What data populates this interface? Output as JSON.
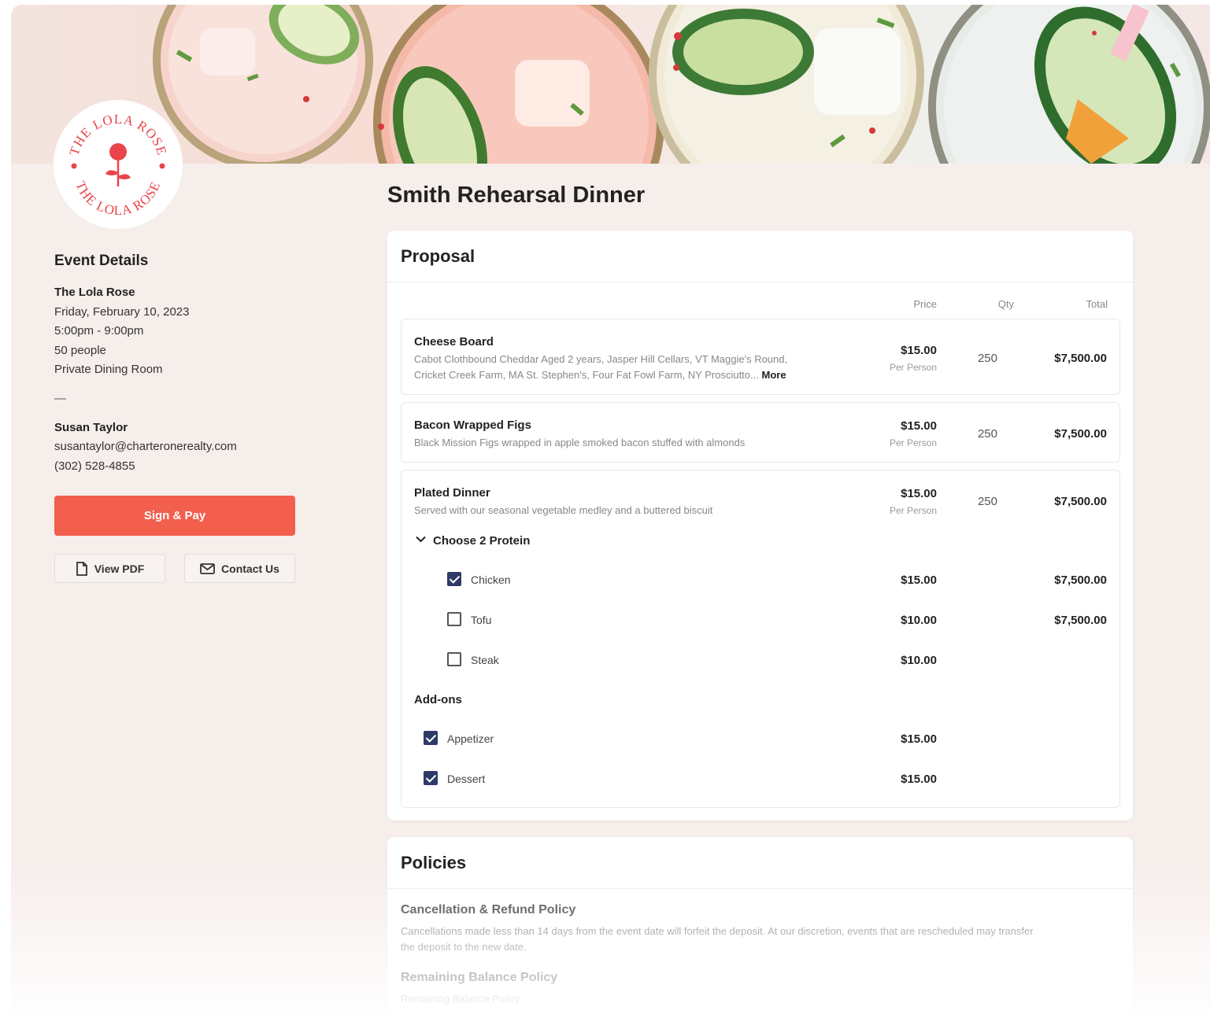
{
  "brand": {
    "logo_text_top": "THE LOLA ROSE",
    "logo_text_bottom": "THE LOLA ROSE",
    "accent_color": "#f25f4c",
    "logo_color": "#e8444a",
    "checkbox_color": "#2e3a66"
  },
  "event": {
    "heading": "Event Details",
    "venue": "The Lola Rose",
    "date": "Friday, February 10, 2023",
    "time": "5:00pm - 9:00pm",
    "guests": "50 people",
    "room": "Private Dining Room",
    "separator": "—",
    "contact_name": "Susan Taylor",
    "contact_email": "susantaylor@charteronerealty.com",
    "contact_phone": "(302) 528-4855"
  },
  "actions": {
    "sign_pay": "Sign & Pay",
    "view_pdf": "View PDF",
    "contact_us": "Contact Us"
  },
  "page_title": "Smith Rehearsal Dinner",
  "proposal": {
    "heading": "Proposal",
    "columns": {
      "price": "Price",
      "qty": "Qty",
      "total": "Total"
    },
    "items": [
      {
        "name": "Cheese Board",
        "desc_line1": "Cabot Clothbound Cheddar Aged 2 years, Jasper Hill Cellars, VT Maggie's Round,",
        "desc_line2": "Cricket Creek Farm, MA St. Stephen's, Four Fat Fowl Farm, NY Prosciutto...",
        "more": "More",
        "price": "$15.00",
        "unit": "Per Person",
        "qty": "250",
        "total": "$7,500.00"
      },
      {
        "name": "Bacon Wrapped Figs",
        "desc_line1": "Black Mission Figs wrapped in apple smoked bacon stuffed with almonds",
        "price": "$15.00",
        "unit": "Per Person",
        "qty": "250",
        "total": "$7,500.00"
      },
      {
        "name": "Plated Dinner",
        "desc_line1": "Served with our seasonal vegetable medley and a buttered biscuit",
        "price": "$15.00",
        "unit": "Per Person",
        "qty": "250",
        "total": "$7,500.00",
        "protein_group": "Choose 2 Protein",
        "proteins": [
          {
            "label": "Chicken",
            "checked": true,
            "price": "$15.00",
            "total": "$7,500.00"
          },
          {
            "label": "Tofu",
            "checked": false,
            "price": "$10.00",
            "total": "$7,500.00"
          },
          {
            "label": "Steak",
            "checked": false,
            "price": "$10.00",
            "total": ""
          }
        ],
        "addons_heading": "Add-ons",
        "addons": [
          {
            "label": "Appetizer",
            "checked": true,
            "price": "$15.00"
          },
          {
            "label": "Dessert",
            "checked": true,
            "price": "$15.00"
          }
        ]
      }
    ]
  },
  "policies": {
    "heading": "Policies",
    "items": [
      {
        "title": "Cancellation & Refund Policy",
        "text_line1": "Cancellations made less than 14 days from the event date will forfeit the deposit. At our discretion, events that are rescheduled may transfer",
        "text_line2": "the deposit to the new date."
      },
      {
        "title": "Remaining Balance Policy",
        "text_line1": "Remaining Balance Policy"
      }
    ]
  }
}
